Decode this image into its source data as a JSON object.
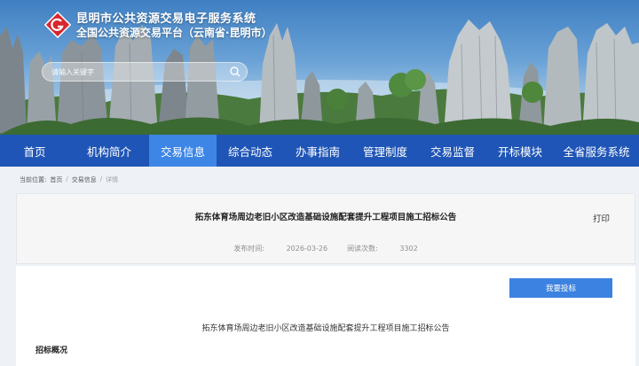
{
  "site": {
    "title_line_1": "昆明市公共资源交易电子服务系统",
    "title_line_2": "全国公共资源交易平台（云南省·昆明市）"
  },
  "search": {
    "placeholder": "请输入关键字"
  },
  "nav": {
    "items": [
      {
        "label": "首页"
      },
      {
        "label": "机构简介"
      },
      {
        "label": "交易信息"
      },
      {
        "label": "综合动态"
      },
      {
        "label": "办事指南"
      },
      {
        "label": "管理制度"
      },
      {
        "label": "交易监督"
      },
      {
        "label": "开标模块"
      },
      {
        "label": "全省服务系统"
      }
    ],
    "active_index": 2,
    "bg_color": "#1f55b6",
    "active_color": "#3d86e6"
  },
  "breadcrumb": {
    "prefix": "当前位置:",
    "home": "首页",
    "section": "交易信息",
    "current": "详情",
    "separator": "/"
  },
  "article": {
    "title": "拓东体育场周边老旧小区改造基础设施配套提升工程项目施工招标公告",
    "print_label": "打印",
    "publish_label": "发布时间:",
    "publish_date": "2026-03-26",
    "views_label": "阅读次数:",
    "views": "3302",
    "bid_button_label": "我要投标",
    "subtitle": "拓东体育场周边老旧小区改造基础设施配套提升工程项目施工招标公告",
    "section_heading": "招标概况"
  }
}
